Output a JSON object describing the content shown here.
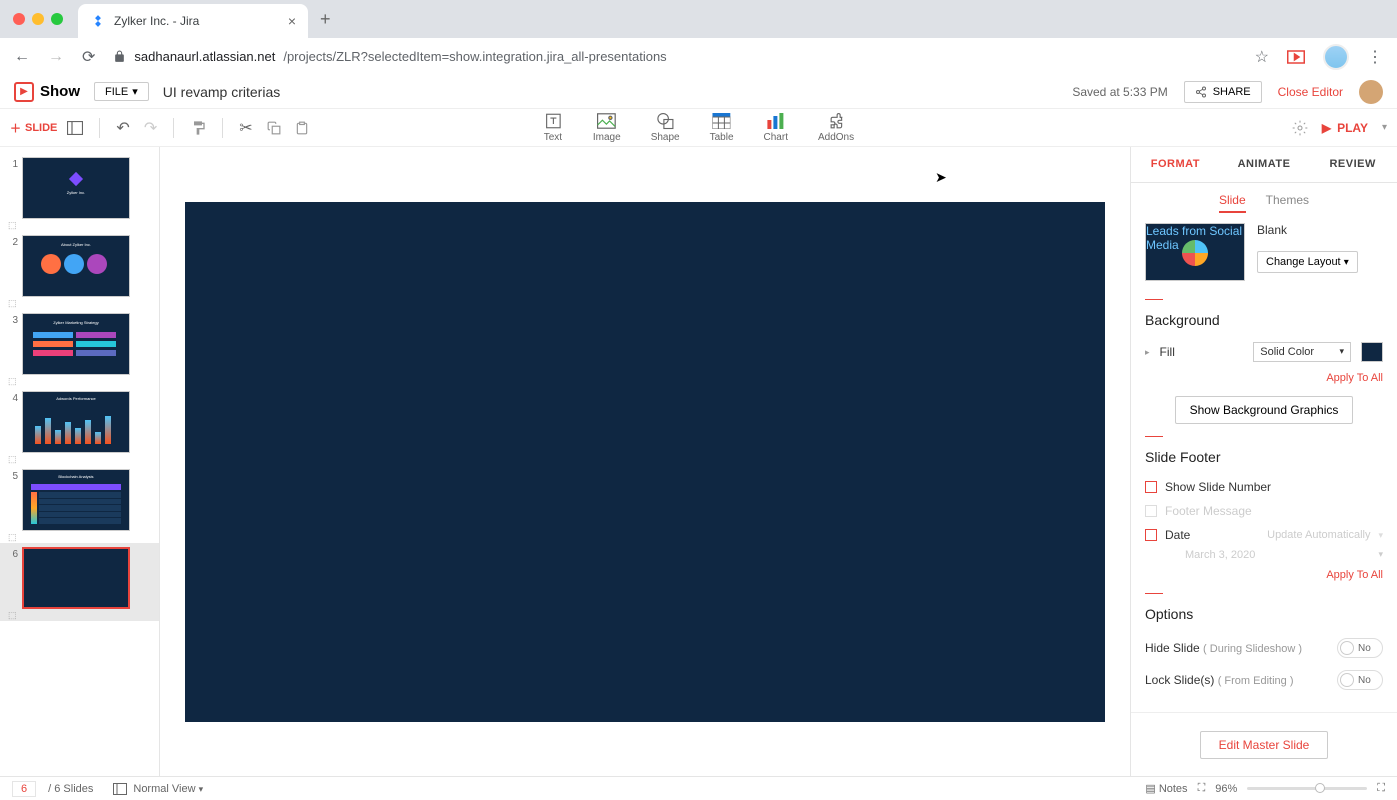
{
  "browser": {
    "tab_title": "Zylker Inc. - Jira",
    "url_host": "sadhanaurl.atlassian.net",
    "url_path": "/projects/ZLR?selectedItem=show.integration.jira_all-presentations"
  },
  "app": {
    "brand": "Show",
    "file_menu": "FILE",
    "doc_title": "UI revamp criterias",
    "saved_at": "Saved at 5:33 PM",
    "share": "SHARE",
    "close_editor": "Close Editor"
  },
  "toolbar": {
    "add_slide": "SLIDE",
    "items": [
      {
        "label": "Text"
      },
      {
        "label": "Image"
      },
      {
        "label": "Shape"
      },
      {
        "label": "Table"
      },
      {
        "label": "Chart"
      },
      {
        "label": "AddOns"
      }
    ],
    "play": "PLAY"
  },
  "panel_tabs": {
    "format": "FORMAT",
    "animate": "ANIMATE",
    "review": "REVIEW"
  },
  "sub_tabs": {
    "slide": "Slide",
    "themes": "Themes"
  },
  "layout": {
    "name": "Blank",
    "change": "Change Layout"
  },
  "background": {
    "title": "Background",
    "fill_label": "Fill",
    "fill_type": "Solid Color",
    "apply_all": "Apply To All",
    "show_graphics": "Show Background Graphics"
  },
  "footer": {
    "title": "Slide Footer",
    "show_number": "Show Slide Number",
    "footer_msg": "Footer Message",
    "date": "Date",
    "update_auto": "Update Automatically",
    "date_value": "March 3, 2020",
    "apply_all": "Apply To All"
  },
  "options": {
    "title": "Options",
    "hide_slide": "Hide Slide",
    "hide_hint": "( During Slideshow )",
    "lock_slide": "Lock Slide(s)",
    "lock_hint": "( From Editing )",
    "toggle_no": "No",
    "edit_master": "Edit Master Slide"
  },
  "status": {
    "current": "6",
    "total": "/ 6 Slides",
    "view": "Normal View",
    "notes": "Notes",
    "zoom": "96%"
  },
  "thumbnails": [
    {
      "n": "1"
    },
    {
      "n": "2"
    },
    {
      "n": "3"
    },
    {
      "n": "4"
    },
    {
      "n": "5"
    },
    {
      "n": "6"
    }
  ]
}
